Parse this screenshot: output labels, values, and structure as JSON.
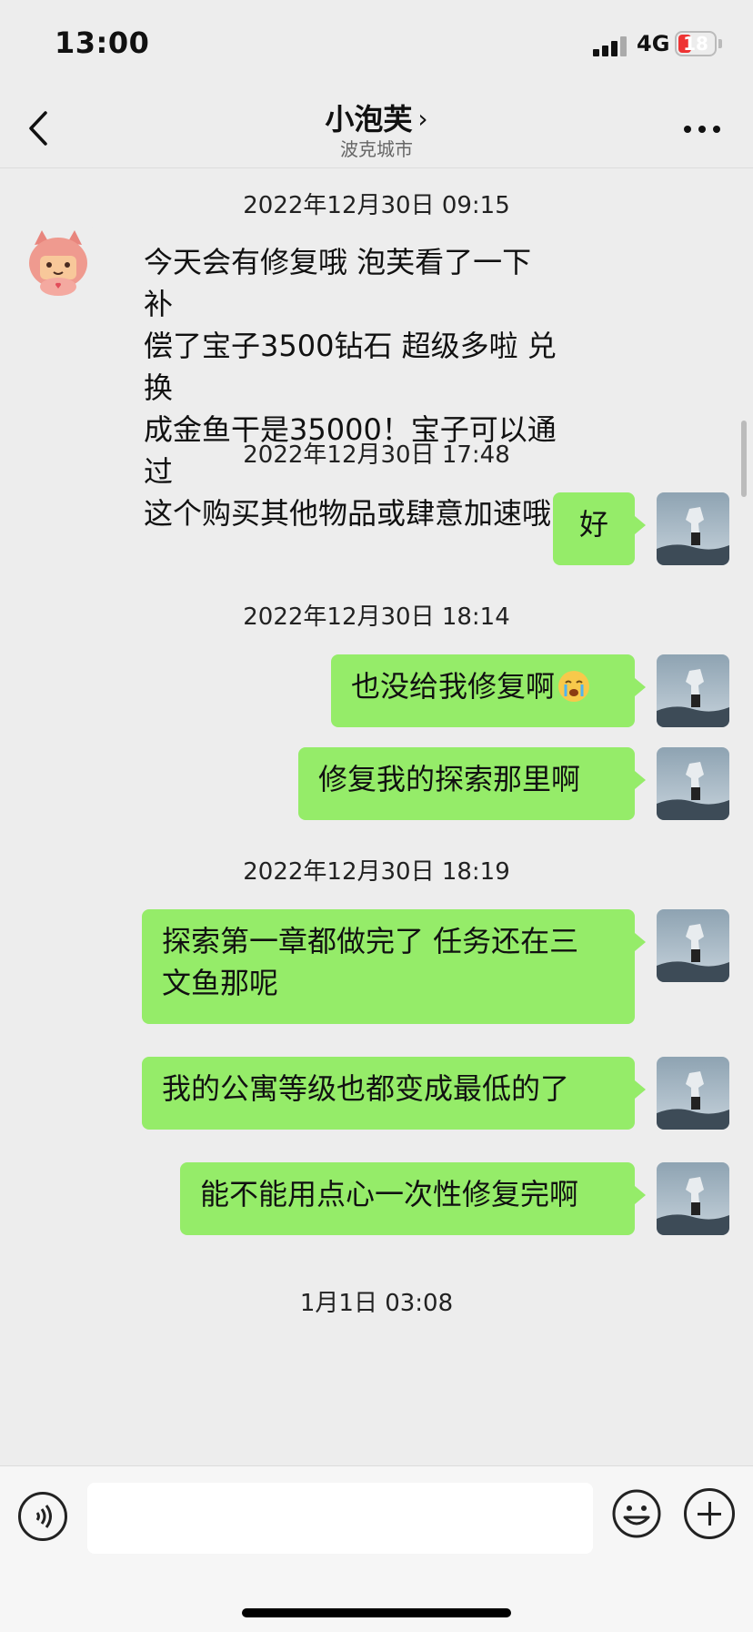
{
  "status": {
    "time": "13:00",
    "network": "4G",
    "battery": "18",
    "battery_color": "#ee3333"
  },
  "header": {
    "title": "小泡芙",
    "subtitle": "波克城市"
  },
  "messages": [
    {
      "ts": "2022年12月30日 09:15"
    },
    {
      "from": "other",
      "text": "今天会有修复哦 泡芙看了一下补偿了宝子3500钻石 超级多啦 兑换成金鱼干是35000！宝子可以通过这个购买其他物品或肆意加速哦",
      "lines": [
        "今天会有修复哦  泡芙看了一下补",
        "偿了宝子3500钻石 超级多啦 兑换",
        "成金鱼干是35000！宝子可以通过",
        "这个购买其他物品或肆意加速哦"
      ]
    },
    {
      "ts": "2022年12月30日 17:48"
    },
    {
      "from": "me",
      "text": "好"
    },
    {
      "ts": "2022年12月30日 18:14"
    },
    {
      "from": "me",
      "text": "也没给我修复啊",
      "emoji": "crying-emoji"
    },
    {
      "from": "me",
      "text": "修复我的探索那里啊"
    },
    {
      "ts": "2022年12月30日 18:19"
    },
    {
      "from": "me",
      "text": "探索第一章都做完了 任务还在三文鱼那呢",
      "lines": [
        "探索第一章都做完了 任务还在三",
        "文鱼那呢"
      ]
    },
    {
      "from": "me",
      "text": "我的公寓等级也都变成最低的了"
    },
    {
      "from": "me",
      "text": "能不能用点心一次性修复完啊"
    },
    {
      "ts": "1月1日 03:08"
    }
  ],
  "colors": {
    "my_bubble": "#95ec69",
    "background": "#ededed"
  },
  "icons": {
    "back": "chevron-left-icon",
    "more": "more-dots-icon",
    "voice": "voice-icon",
    "emoji": "smiley-icon",
    "plus": "plus-circle-icon"
  }
}
